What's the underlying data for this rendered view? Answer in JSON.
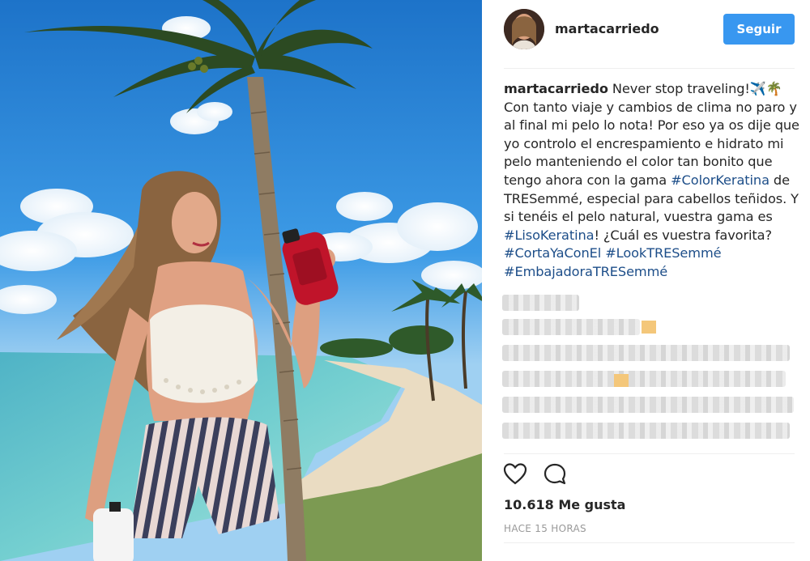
{
  "header": {
    "username": "martacarriedo",
    "follow_label": "Seguir"
  },
  "caption": {
    "username": "martacarriedo",
    "segments": [
      {
        "text": "Never stop traveling!✈️🌴",
        "tag": false
      },
      {
        "text": "Con tanto viaje y cambios de clima no paro y al final mi pelo lo nota! Por eso ya os dije que yo controlo el encrespamiento e hidrato mi pelo manteniendo el color tan bonito que tengo ahora con la gama ",
        "tag": false
      },
      {
        "text": "#ColorKeratina",
        "tag": true
      },
      {
        "text": " de TRESemmé, especial para cabellos teñidos. Y si tenéis el pelo natural, vuestra gama es ",
        "tag": false
      },
      {
        "text": "#LisoKeratina",
        "tag": true
      },
      {
        "text": "! ¿Cuál es vuestra favorita? ",
        "tag": false
      },
      {
        "text": "#CortaYaConEl",
        "tag": true
      },
      {
        "text": " ",
        "tag": false
      },
      {
        "text": "#LookTRESemmé",
        "tag": true
      },
      {
        "text": " ",
        "tag": false
      },
      {
        "text": "#EmbajadoraTRESemmé",
        "tag": true
      }
    ]
  },
  "actions": {
    "like_icon": "heart-icon",
    "comment_icon": "comment-icon"
  },
  "likes": "10.618 Me gusta",
  "time": "HACE 15 HORAS"
}
